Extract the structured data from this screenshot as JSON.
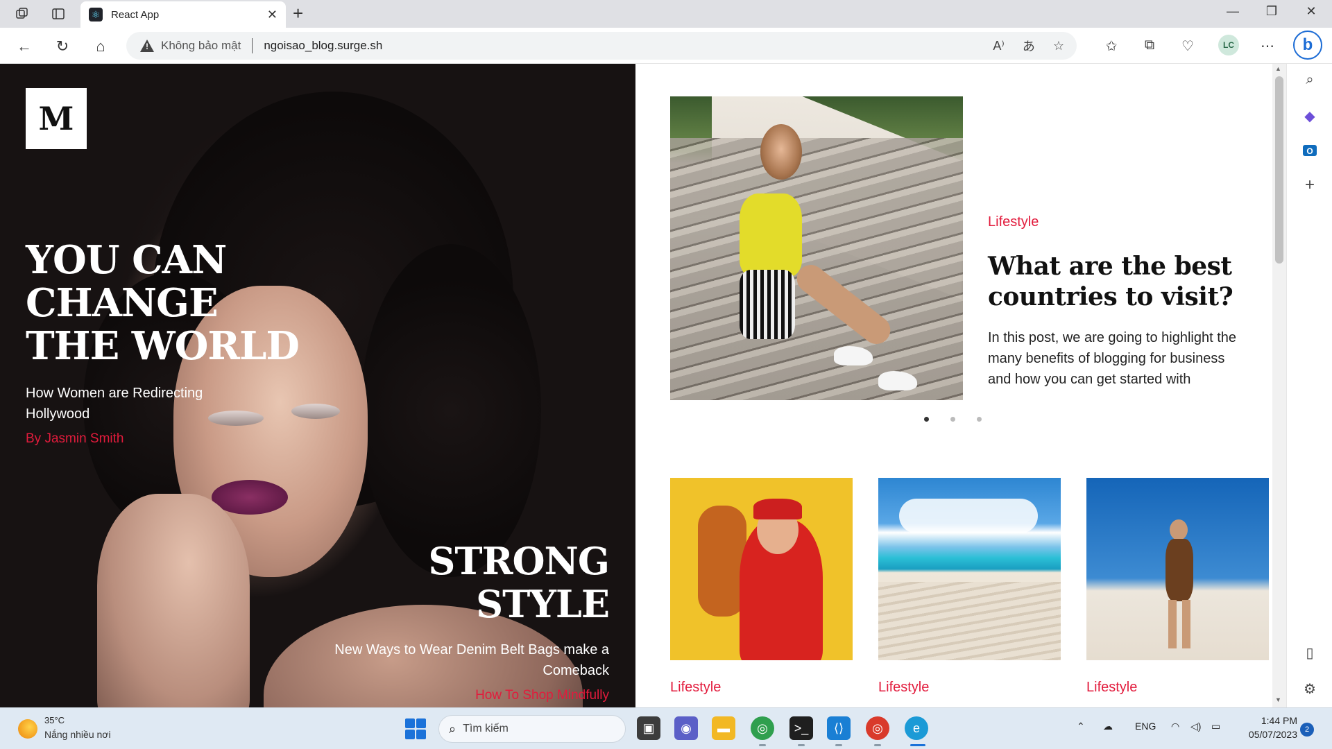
{
  "browser": {
    "tab_title": "React App",
    "address_warning": "Không bảo mật",
    "url": "ngoisao_blog.surge.sh",
    "profile_initials": "LC",
    "bing_label": "b"
  },
  "page": {
    "logo": "M",
    "hero": {
      "title": "YOU CAN CHANGE THE WORLD",
      "subtitle": "How Women are Redirecting Hollywood",
      "author": "By Jasmin Smith"
    },
    "hero2": {
      "title": "STRONG STYLE",
      "subtitle": "New Ways to Wear Denim Belt Bags make a Comeback",
      "author": "How To Shop Mindfully"
    },
    "featured": {
      "category": "Lifestyle",
      "title": "What are the best countries to visit?",
      "excerpt": "In this post, we are going to highlight the many benefits of blogging for business and how you can get started with",
      "slide_count": 3,
      "active_slide": 1
    },
    "cards": [
      {
        "category": "Lifestyle"
      },
      {
        "category": "Lifestyle"
      },
      {
        "category": "Lifestyle"
      }
    ]
  },
  "taskbar": {
    "weather_temp": "35°C",
    "weather_desc": "Nắng nhiều nơi",
    "search_placeholder": "Tìm kiếm",
    "language": "ENG",
    "time": "1:44 PM",
    "date": "05/07/2023",
    "notification_count": "2"
  },
  "colors": {
    "accent": "#e21b3c",
    "hero_text": "#ffffff"
  }
}
